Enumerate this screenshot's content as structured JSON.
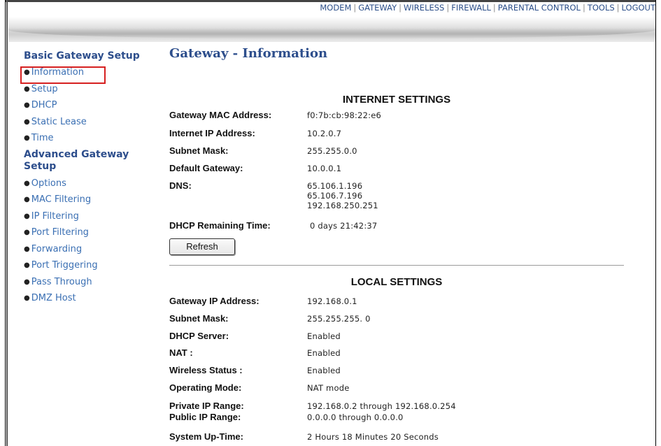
{
  "topnav": {
    "items": [
      "MODEM",
      "GATEWAY",
      "WIRELESS",
      "FIREWALL",
      "PARENTAL CONTROL",
      "TOOLS",
      "LOGOUT"
    ],
    "separator": "|"
  },
  "sidebar": {
    "basic_heading": "Basic Gateway Setup",
    "basic_items": [
      "Information",
      "Setup",
      "DHCP",
      "Static Lease",
      "Time"
    ],
    "advanced_heading_line1": "Advanced Gateway",
    "advanced_heading_line2": "Setup",
    "advanced_items": [
      "Options",
      "MAC Filtering",
      "IP Filtering",
      "Port Filtering",
      "Forwarding",
      "Port Triggering",
      "Pass Through",
      "DMZ Host"
    ],
    "bullet": "●"
  },
  "page_title": "Gateway - Information",
  "internet": {
    "title": "INTERNET SETTINGS",
    "rows": [
      {
        "label": "Gateway MAC Address:",
        "value": "f0:7b:cb:98:22:e6"
      },
      {
        "label": "Internet IP Address:",
        "value": "10.2.0.7"
      },
      {
        "label": "Subnet Mask:",
        "value": "255.255.0.0"
      },
      {
        "label": "Default Gateway:",
        "value": "10.0.0.1"
      },
      {
        "label": "DNS:",
        "values": [
          "65.106.1.196",
          "65.106.7.196",
          "192.168.250.251"
        ]
      },
      {
        "label": "DHCP Remaining Time:",
        "value": "0 days 21:42:37"
      }
    ],
    "refresh_label": "Refresh"
  },
  "local": {
    "title": "LOCAL SETTINGS",
    "rows": [
      {
        "label": "Gateway IP Address:",
        "value": "192.168.0.1"
      },
      {
        "label": "Subnet Mask:",
        "value": "255.255.255. 0"
      },
      {
        "label": "DHCP Server:",
        "value": "Enabled"
      },
      {
        "label": "NAT :",
        "value": "Enabled"
      },
      {
        "label": "Wireless Status :",
        "value": "Enabled"
      },
      {
        "label": "Operating Mode:",
        "value": "NAT mode"
      },
      {
        "label": "Private IP Range:",
        "value": "192.168.0.2 through 192.168.0.254"
      },
      {
        "label": "Public IP Range:",
        "value": "0.0.0.0 through 0.0.0.0"
      },
      {
        "label": "System Up-Time:",
        "value": "2 Hours 18 Minutes 20 Seconds"
      }
    ]
  },
  "colors": {
    "heading_blue": "#2d4e8c",
    "link_blue": "#3a6fb3",
    "highlight_red": "#d62020"
  }
}
